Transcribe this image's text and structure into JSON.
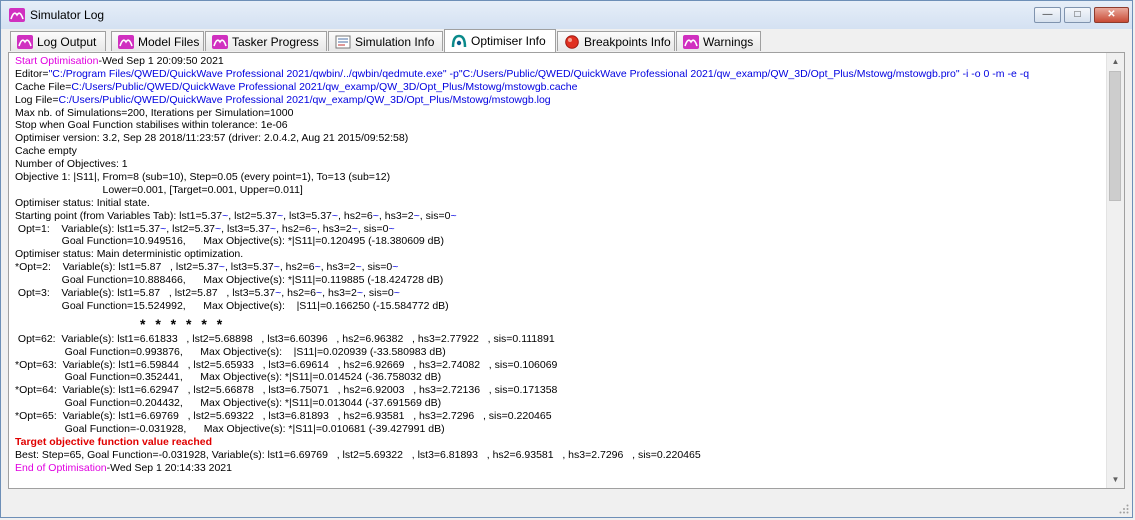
{
  "window": {
    "title": "Simulator Log"
  },
  "controls": {
    "minimize": "—",
    "maximize": "□",
    "close": "✕"
  },
  "tabs": [
    {
      "label": "Log Output",
      "icon": "app-icon"
    },
    {
      "label": "Model Files",
      "icon": "app-icon"
    },
    {
      "label": "Tasker Progress",
      "icon": "app-icon"
    },
    {
      "label": "Simulation Info",
      "icon": "simulation-icon"
    },
    {
      "label": "Optimiser Info",
      "icon": "optimiser-icon",
      "active": true
    },
    {
      "label": "Breakpoints Info",
      "icon": "breakpoint-icon"
    },
    {
      "label": "Warnings",
      "icon": "app-icon"
    }
  ],
  "log": {
    "l1": {
      "a": "Start Optimisation",
      "b": "-Wed Sep 1 20:09:50 2021"
    },
    "l2": {
      "a": "Editor=",
      "b": "\"C:/Program Files/QWED/QuickWave Professional 2021/qwbin/../qwbin/qedmute.exe\" -p\"C:/Users/Public/QWED/QuickWave Professional 2021/qw_examp/QW_3D/Opt_Plus/Mstowg/mstowgb.pro\" -i -o 0 -m -e -q"
    },
    "l3": {
      "a": "Cache File=",
      "b": "C:/Users/Public/QWED/QuickWave Professional 2021/qw_examp/QW_3D/Opt_Plus/Mstowg/mstowgb.cache"
    },
    "l4": {
      "a": "Log File=",
      "b": "C:/Users/Public/QWED/QuickWave Professional 2021/qw_examp/QW_3D/Opt_Plus/Mstowg/mstowgb.log"
    },
    "l5": "Max nb. of Simulations=200, Iterations per Simulation=1000",
    "l6": "Stop when Goal Function stabilises within tolerance: 1e-06",
    "l7": "Optimiser version: 3.2, Sep 28 2018/11:23:57 (driver: 2.0.4.2, Aug 21 2015/09:52:58)",
    "l8": "Cache empty",
    "l9": "Number of Objectives: 1",
    "l10": "Objective 1: |S11|, From=8 (sub=10), Step=0.05 (every point=1), To=13 (sub=12)",
    "l11": "                              Lower=0.001, [Target=0.001, Upper=0.011]",
    "l12": "Optimiser status: Initial state.",
    "l13": {
      "p1": "Starting point (from Variables Tab): lst1=5.37",
      "t1": "~",
      "p2": ", lst2=5.37",
      "t2": "~",
      "p3": ", lst3=5.37",
      "t3": "~",
      "p4": ", hs2=6",
      "t4": "~",
      "p5": ", hs3=2",
      "t5": "~",
      "p6": ", sis=0",
      "t6": "~"
    },
    "l14": {
      "p1": " Opt=1:    Variable(s): lst1=5.37",
      "t1": "~",
      "p2": ", lst2=5.37",
      "t2": "~",
      "p3": ", lst3=5.37",
      "t3": "~",
      "p4": ", hs2=6",
      "t4": "~",
      "p5": ", hs3=2",
      "t5": "~",
      "p6": ", sis=0",
      "t6": "~"
    },
    "l15": "                Goal Function=10.949516,      Max Objective(s): *|S11|=0.120495 (-18.380609 dB)",
    "l16": "Optimiser status: Main deterministic optimization.",
    "l17": {
      "p1": "*Opt=2:    Variable(s): lst1=5.87   , lst2=5.37",
      "t1": "~",
      "p2": ", lst3=5.37",
      "t2": "~",
      "p3": ", hs2=6",
      "t3": "~",
      "p4": ", hs3=2",
      "t4": "~",
      "p5": ", sis=0",
      "t5": "~"
    },
    "l18": "                Goal Function=10.888466,      Max Objective(s): *|S11|=0.119885 (-18.424728 dB)",
    "l19": {
      "p1": " Opt=3:    Variable(s): lst1=5.87   , lst2=5.87   , lst3=5.37",
      "t1": "~",
      "p2": ", hs2=6",
      "t2": "~",
      "p3": ", hs3=2",
      "t3": "~",
      "p4": ", sis=0",
      "t4": "~"
    },
    "l20": "                Goal Function=15.524992,      Max Objective(s):    |S11|=0.166250 (-15.584772 dB)",
    "stars": "* * * * * *",
    "l22": " Opt=62:  Variable(s): lst1=6.61833   , lst2=5.68898   , lst3=6.60396   , hs2=6.96382   , hs3=2.77922   , sis=0.111891",
    "l23": "                 Goal Function=0.993876,      Max Objective(s):    |S11|=0.020939 (-33.580983 dB)",
    "l24": "*Opt=63:  Variable(s): lst1=6.59844   , lst2=5.65933   , lst3=6.69614   , hs2=6.92669   , hs3=2.74082   , sis=0.106069",
    "l25": "                 Goal Function=0.352441,      Max Objective(s): *|S11|=0.014524 (-36.758032 dB)",
    "l26": "*Opt=64:  Variable(s): lst1=6.62947   , lst2=5.66878   , lst3=6.75071   , hs2=6.92003   , hs3=2.72136   , sis=0.171358",
    "l27": "                 Goal Function=0.204432,      Max Objective(s): *|S11|=0.013044 (-37.691569 dB)",
    "l28": "*Opt=65:  Variable(s): lst1=6.69769   , lst2=5.69322   , lst3=6.81893   , hs2=6.93581   , hs3=2.7296   , sis=0.220465",
    "l29": "                 Goal Function=-0.031928,      Max Objective(s): *|S11|=0.010681 (-39.427991 dB)",
    "l30": "Target objective function value reached",
    "l31": "Best: Step=65, Goal Function=-0.031928, Variable(s): lst1=6.69769   , lst2=5.69322   , lst3=6.81893   , hs2=6.93581   , hs3=2.7296   , sis=0.220465",
    "l32": {
      "a": "End of Optimisation",
      "b": "-Wed Sep 1 20:14:33 2021"
    }
  },
  "colors": {
    "start_end": "#e000e0",
    "path": "#0000e0",
    "target": "#e00000"
  }
}
